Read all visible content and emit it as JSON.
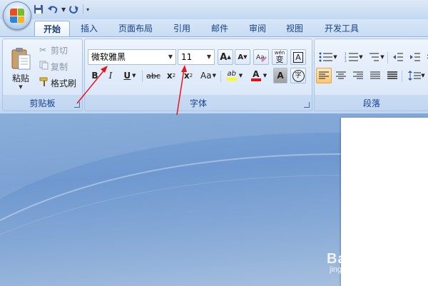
{
  "quick_access": {
    "save_icon": "save-icon",
    "undo_icon": "undo-icon",
    "redo_icon": "redo-icon",
    "customize_icon": "customize-quick-access-icon"
  },
  "tabs": [
    "开始",
    "插入",
    "页面布局",
    "引用",
    "邮件",
    "审阅",
    "视图",
    "开发工具"
  ],
  "active_tab": "开始",
  "clipboard": {
    "group_label": "剪贴板",
    "paste_label": "粘贴",
    "cut_label": "剪切",
    "copy_label": "复制",
    "format_painter_label": "格式刷"
  },
  "font": {
    "group_label": "字体",
    "font_name": "微软雅黑",
    "font_size": "11",
    "grow_label": "A",
    "shrink_label": "A",
    "phonetic_label": "wén",
    "phonetic_char": "变",
    "border_label": "A",
    "bold": "B",
    "italic": "I",
    "underline": "U",
    "strikethrough": "abc",
    "subscript": "x",
    "subscript_mark": "2",
    "superscript": "x",
    "superscript_mark": "2",
    "change_case": "Aa",
    "highlight_label": "ab",
    "font_color_label": "A",
    "shading_label": "A",
    "enclose_char": "字"
  },
  "paragraph": {
    "group_label": "段落"
  },
  "colors": {
    "highlight": "#ffff00",
    "font_color": "#e01010",
    "arrow": "#e8141a"
  },
  "watermark": {
    "text": "Bai 经验",
    "sub": "jingyan.baidu.com"
  }
}
